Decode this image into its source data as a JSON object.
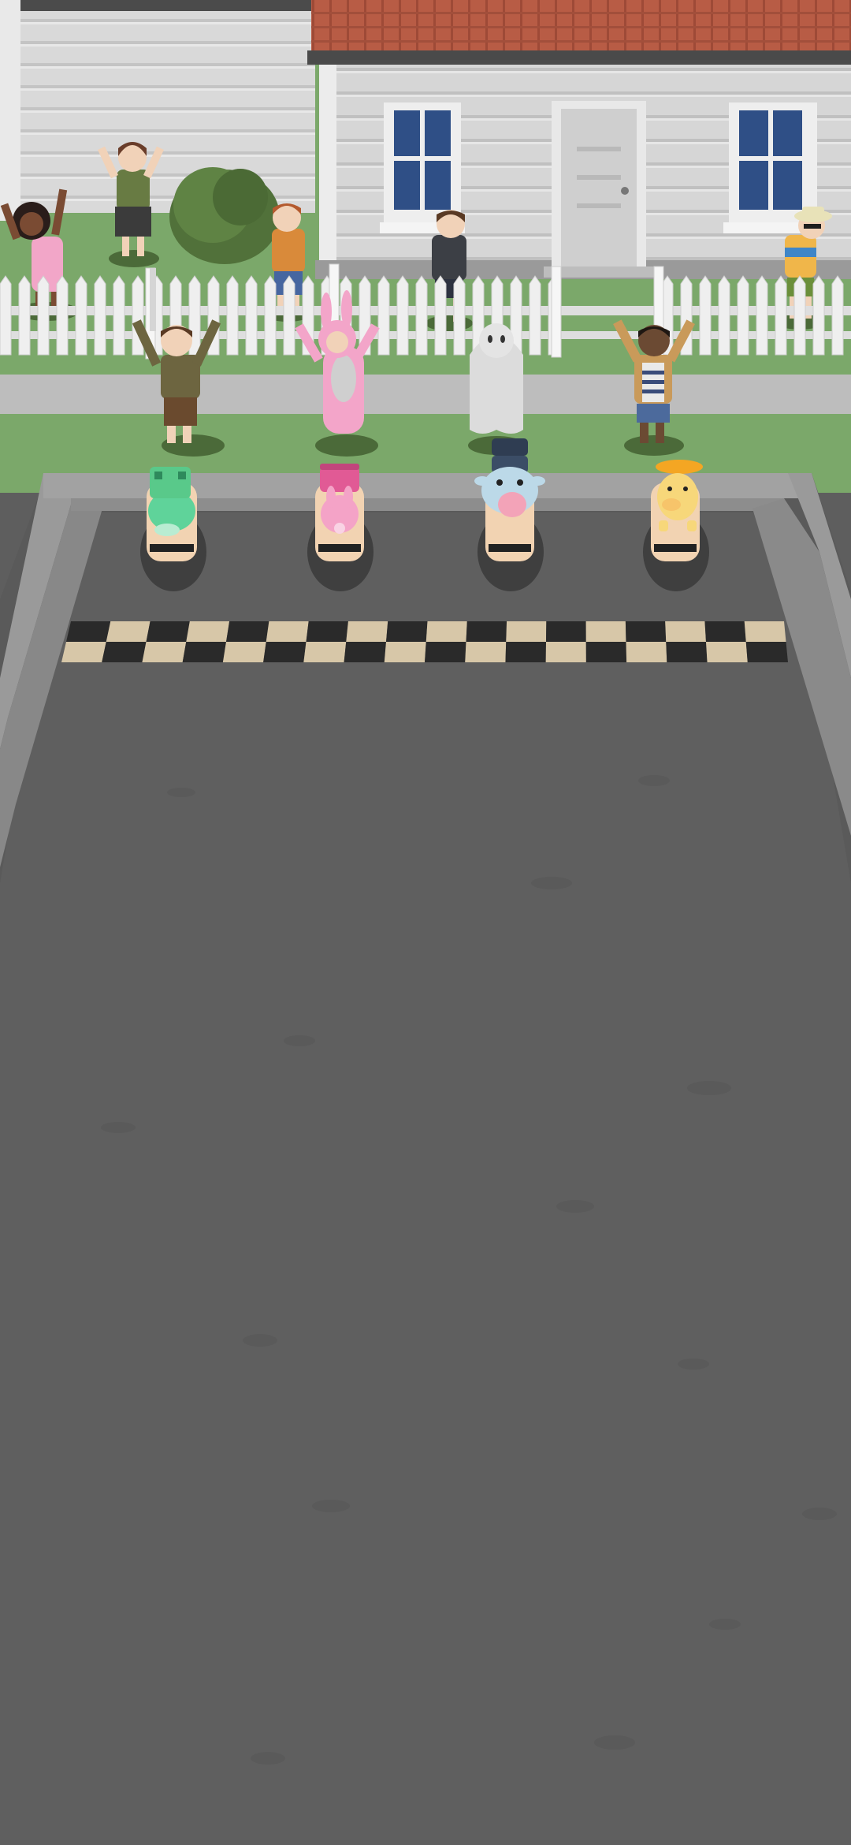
{
  "scene": {
    "type": "skateboard-race-start",
    "colors": {
      "asphalt": "#5f5f5f",
      "asphalt_far": "#575757",
      "curb": "#8d8d8d",
      "curb_light": "#a8a8a8",
      "grass": "#7ba86a",
      "sidewalk": "#bdbdbd",
      "house_siding": "#d7d7d7",
      "roof": "#b85c45",
      "window": "#2f4f86",
      "fence": "#efefef",
      "checker_dark": "#2a2a2a",
      "checker_light": "#d7c7a8"
    },
    "spectators": [
      {
        "name": "spectator-pink-dress"
      },
      {
        "name": "spectator-green-shirt-girl"
      },
      {
        "name": "spectator-boy-orange"
      },
      {
        "name": "spectator-gray-shirt"
      },
      {
        "name": "spectator-hat-kid"
      },
      {
        "name": "spectator-scout-boy"
      },
      {
        "name": "spectator-bunny-suit"
      },
      {
        "name": "spectator-ghost-costume"
      },
      {
        "name": "spectator-striped-shirt"
      }
    ],
    "racers": [
      {
        "name": "racer-green-frog",
        "color": "#5fd39a"
      },
      {
        "name": "racer-pink-bunny",
        "color": "#f4a3c7"
      },
      {
        "name": "racer-blue-cow",
        "color": "#bcd9e8"
      },
      {
        "name": "racer-yellow-duck",
        "color": "#f7d77a"
      }
    ]
  }
}
